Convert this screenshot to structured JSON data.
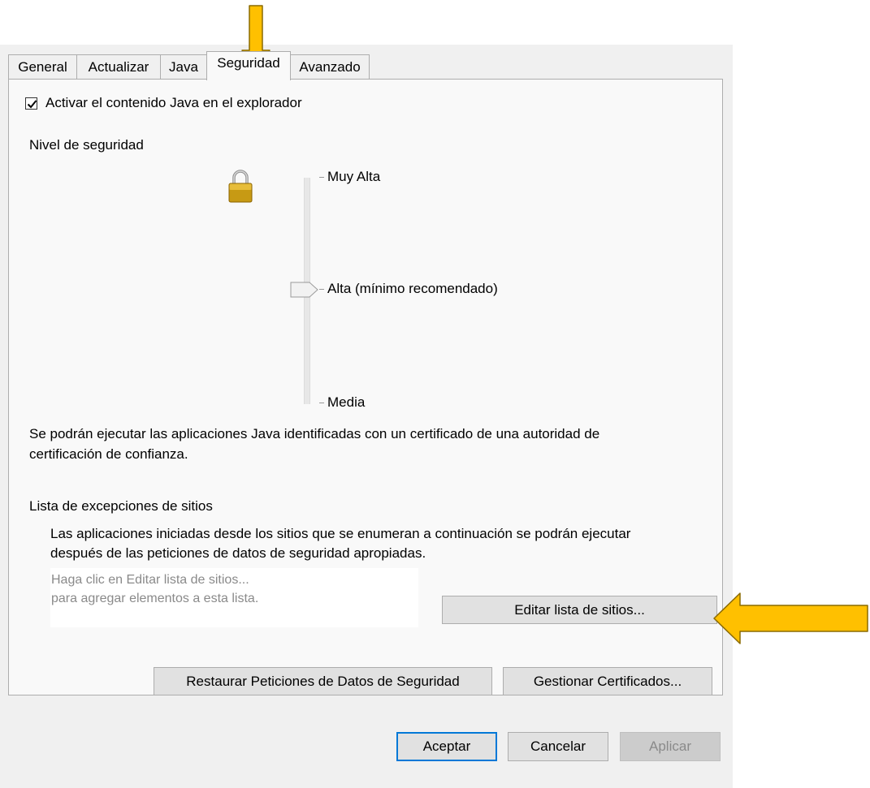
{
  "tabs": [
    {
      "label": "General"
    },
    {
      "label": "Actualizar"
    },
    {
      "label": "Java"
    },
    {
      "label": "Seguridad",
      "active": true
    },
    {
      "label": "Avanzado"
    }
  ],
  "security": {
    "enable_java_label": "Activar el contenido Java en el explorador",
    "enable_java_checked": true,
    "level_heading": "Nivel de seguridad",
    "levels": [
      "Muy Alta",
      "Alta (mínimo recomendado)",
      "Media"
    ],
    "selected_level": "Alta (mínimo recomendado)",
    "description_line1": "Se podrán ejecutar las aplicaciones Java identificadas con un certificado de una autoridad de",
    "description_line2": "certificación de confianza."
  },
  "exceptions": {
    "heading": "Lista de excepciones de sitios",
    "info_line1": "Las aplicaciones iniciadas desde los sitios que se enumeran a continuación se podrán ejecutar",
    "info_line2": "después de las peticiones de datos de seguridad apropiadas.",
    "placeholder_line1": "Haga clic en Editar lista de sitios...",
    "placeholder_line2": "para agregar elementos a esta lista.",
    "edit_button": "Editar lista de sitios..."
  },
  "actions": {
    "restore_button": "Restaurar Peticiones de Datos de Seguridad",
    "certificates_button": "Gestionar Certificados..."
  },
  "footer": {
    "ok": "Aceptar",
    "cancel": "Cancelar",
    "apply": "Aplicar"
  },
  "colors": {
    "annotation_arrow": "#ffc000",
    "annotation_arrow_border": "#8a6a00"
  }
}
